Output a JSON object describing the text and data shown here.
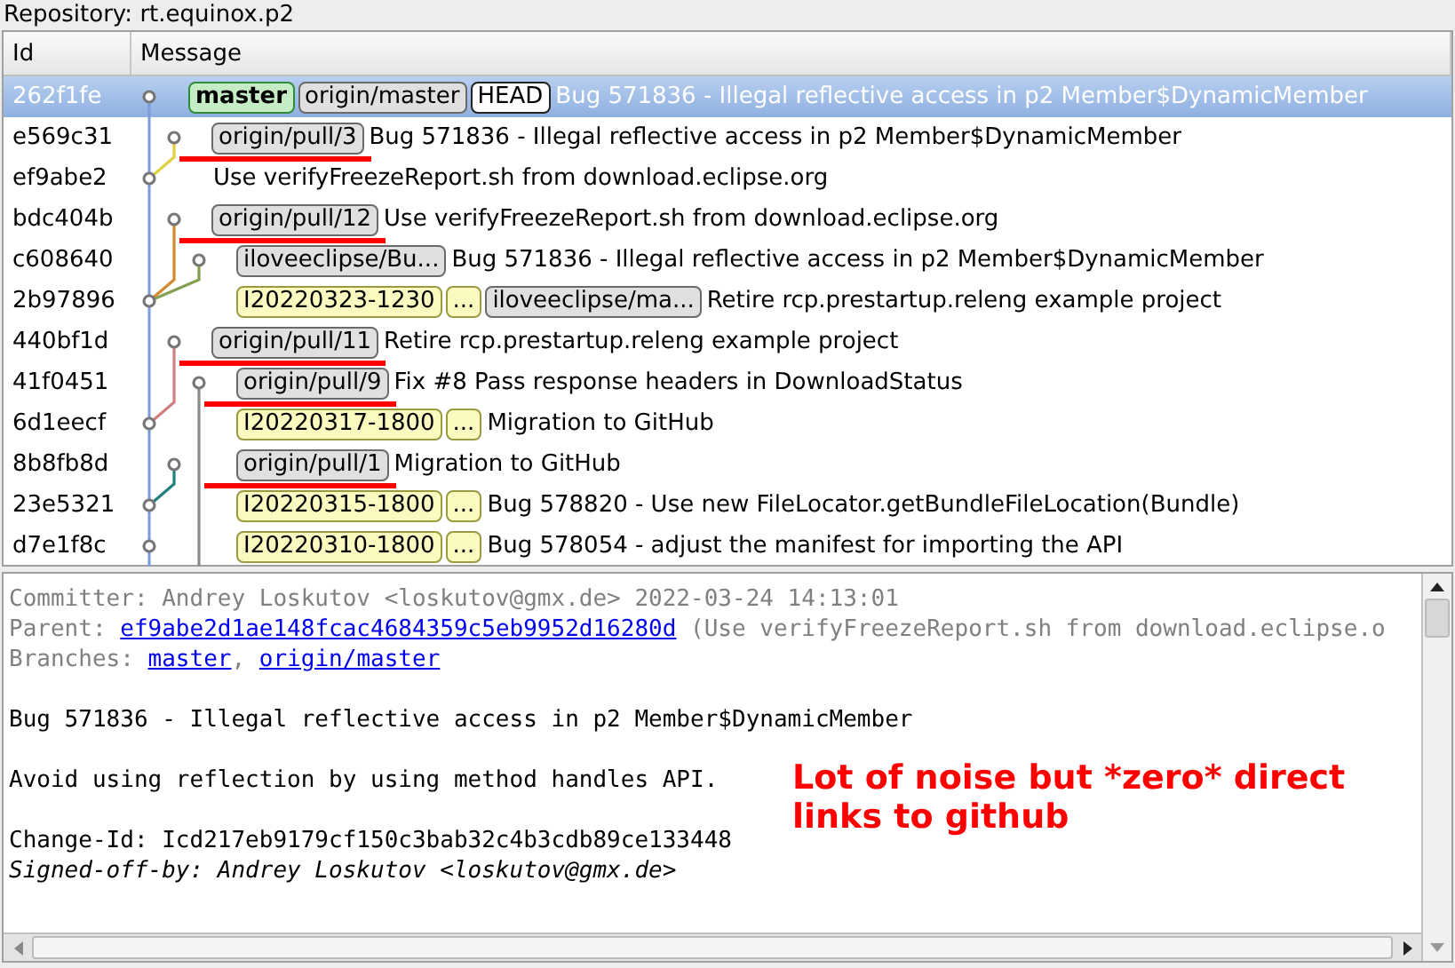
{
  "repository_label": "Repository: rt.equinox.p2",
  "table": {
    "columns": [
      "Id",
      "Message"
    ],
    "rows": [
      {
        "id": "262f1fe",
        "selected": true,
        "refs": [
          {
            "label": "master",
            "kind": "head"
          },
          {
            "label": "origin/master",
            "kind": "remote"
          },
          {
            "label": "HEAD",
            "kind": "headref"
          }
        ],
        "message": "Bug 571836 - Illegal reflective access in p2 Member$DynamicMember"
      },
      {
        "id": "e569c31",
        "selected": false,
        "refs": [
          {
            "label": "origin/pull/3",
            "kind": "remote",
            "underlined": true
          }
        ],
        "message": "Bug 571836 - Illegal reflective access in p2 Member$DynamicMember"
      },
      {
        "id": "ef9abe2",
        "selected": false,
        "refs": [],
        "message": "Use verifyFreezeReport.sh from download.eclipse.org"
      },
      {
        "id": "bdc404b",
        "selected": false,
        "refs": [
          {
            "label": "origin/pull/12",
            "kind": "remote",
            "underlined": true
          }
        ],
        "message": "Use verifyFreezeReport.sh from download.eclipse.org"
      },
      {
        "id": "c608640",
        "selected": false,
        "refs": [
          {
            "label": "iloveeclipse/Bu...",
            "kind": "remote"
          }
        ],
        "message": "Bug 571836 - Illegal reflective access in p2 Member$DynamicMember"
      },
      {
        "id": "2b97896",
        "selected": false,
        "refs": [
          {
            "label": "I20220323-1230",
            "kind": "tag"
          },
          {
            "label": "...",
            "kind": "tag"
          },
          {
            "label": "iloveeclipse/ma...",
            "kind": "remote"
          }
        ],
        "message": "Retire rcp.prestartup.releng example project"
      },
      {
        "id": "440bf1d",
        "selected": false,
        "refs": [
          {
            "label": "origin/pull/11",
            "kind": "remote",
            "underlined": true
          }
        ],
        "message": "Retire rcp.prestartup.releng example project"
      },
      {
        "id": "41f0451",
        "selected": false,
        "refs": [
          {
            "label": "origin/pull/9",
            "kind": "remote",
            "underlined": true
          }
        ],
        "message": "Fix #8 Pass response headers in DownloadStatus"
      },
      {
        "id": "6d1eecf",
        "selected": false,
        "refs": [
          {
            "label": "I20220317-1800",
            "kind": "tag"
          },
          {
            "label": "...",
            "kind": "tag"
          }
        ],
        "message": "Migration to GitHub"
      },
      {
        "id": "8b8fb8d",
        "selected": false,
        "refs": [
          {
            "label": "origin/pull/1",
            "kind": "remote",
            "underlined": true
          }
        ],
        "message": "Migration to GitHub"
      },
      {
        "id": "23e5321",
        "selected": false,
        "refs": [
          {
            "label": "I20220315-1800",
            "kind": "tag"
          },
          {
            "label": "...",
            "kind": "tag"
          }
        ],
        "message": "Bug 578820 - Use new FileLocator.getBundleFileLocation(Bundle)"
      },
      {
        "id": "d7e1f8c",
        "selected": false,
        "refs": [
          {
            "label": "I20220310-1800",
            "kind": "tag"
          },
          {
            "label": "...",
            "kind": "tag"
          }
        ],
        "message": "Bug 578054 - adjust the manifest for importing the API"
      }
    ]
  },
  "details": {
    "committer": "Committer: Andrey Loskutov <loskutov@gmx.de> 2022-03-24 14:13:01",
    "parent_label": "Parent: ",
    "parent_hash": "ef9abe2d1ae148fcac4684359c5eb9952d16280d",
    "parent_note": " (Use verifyFreezeReport.sh from download.eclipse.o",
    "branches_label": "Branches: ",
    "branches": [
      "master",
      "origin/master"
    ],
    "branch_separator": ", ",
    "subject": "Bug 571836 - Illegal reflective access in p2 Member$DynamicMember",
    "body": "Avoid using reflection by using method handles API.",
    "change_id": "Change-Id: Icd217eb9179cf150c3bab32c4b3cdb89ce133448",
    "signed_off": "Signed-off-by: Andrey Loskutov <loskutov@gmx.de>"
  },
  "annotation": "Lot of noise but *zero* direct links to github"
}
